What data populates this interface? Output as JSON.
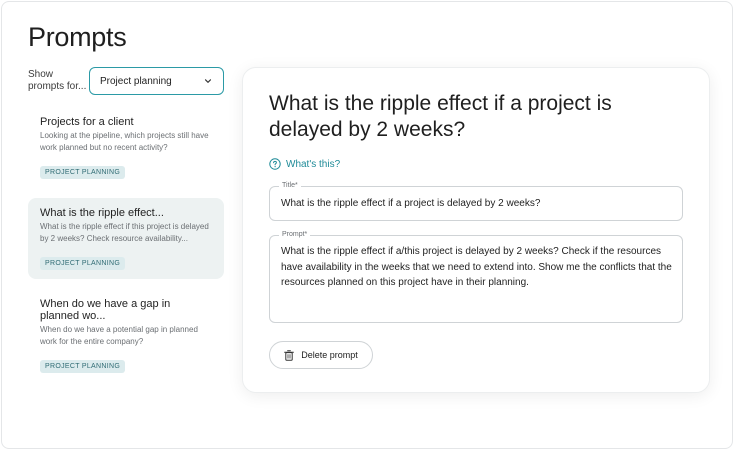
{
  "page": {
    "title": "Prompts"
  },
  "filter": {
    "label": "Show prompts for...",
    "selected": "Project planning",
    "icon": "chevron-down-icon"
  },
  "prompts": [
    {
      "title": "Projects for a client",
      "description": "Looking at the pipeline, which projects still have work planned but no recent activity?",
      "badge": "PROJECT PLANNING",
      "active": false
    },
    {
      "title": "What is the ripple effect...",
      "description": "What is the ripple effect if this project is delayed by 2 weeks? Check resource availability...",
      "badge": "PROJECT PLANNING",
      "active": true
    },
    {
      "title": "When do we have a gap in planned wo...",
      "description": "When do we have a potential gap in planned work for the entire company?",
      "badge": "PROJECT PLANNING",
      "active": false
    }
  ],
  "detail": {
    "heading": "What is the ripple effect if a project is delayed by 2 weeks?",
    "whats_this": "What's this?",
    "title_label": "Title*",
    "title_value": "What is the ripple effect if a project is delayed by 2 weeks?",
    "prompt_label": "Prompt*",
    "prompt_value": "What is the ripple effect if a/this project is delayed by 2 weeks? Check if the resources have availability in the weeks that we need to extend into. Show me the conflicts that the resources planned on this project have in their planning.",
    "delete_label": "Delete prompt"
  },
  "colors": {
    "accent": "#2b9aa6",
    "active_bg": "#edf2f2",
    "badge_bg": "#dcebed",
    "badge_text": "#2f6b73"
  }
}
